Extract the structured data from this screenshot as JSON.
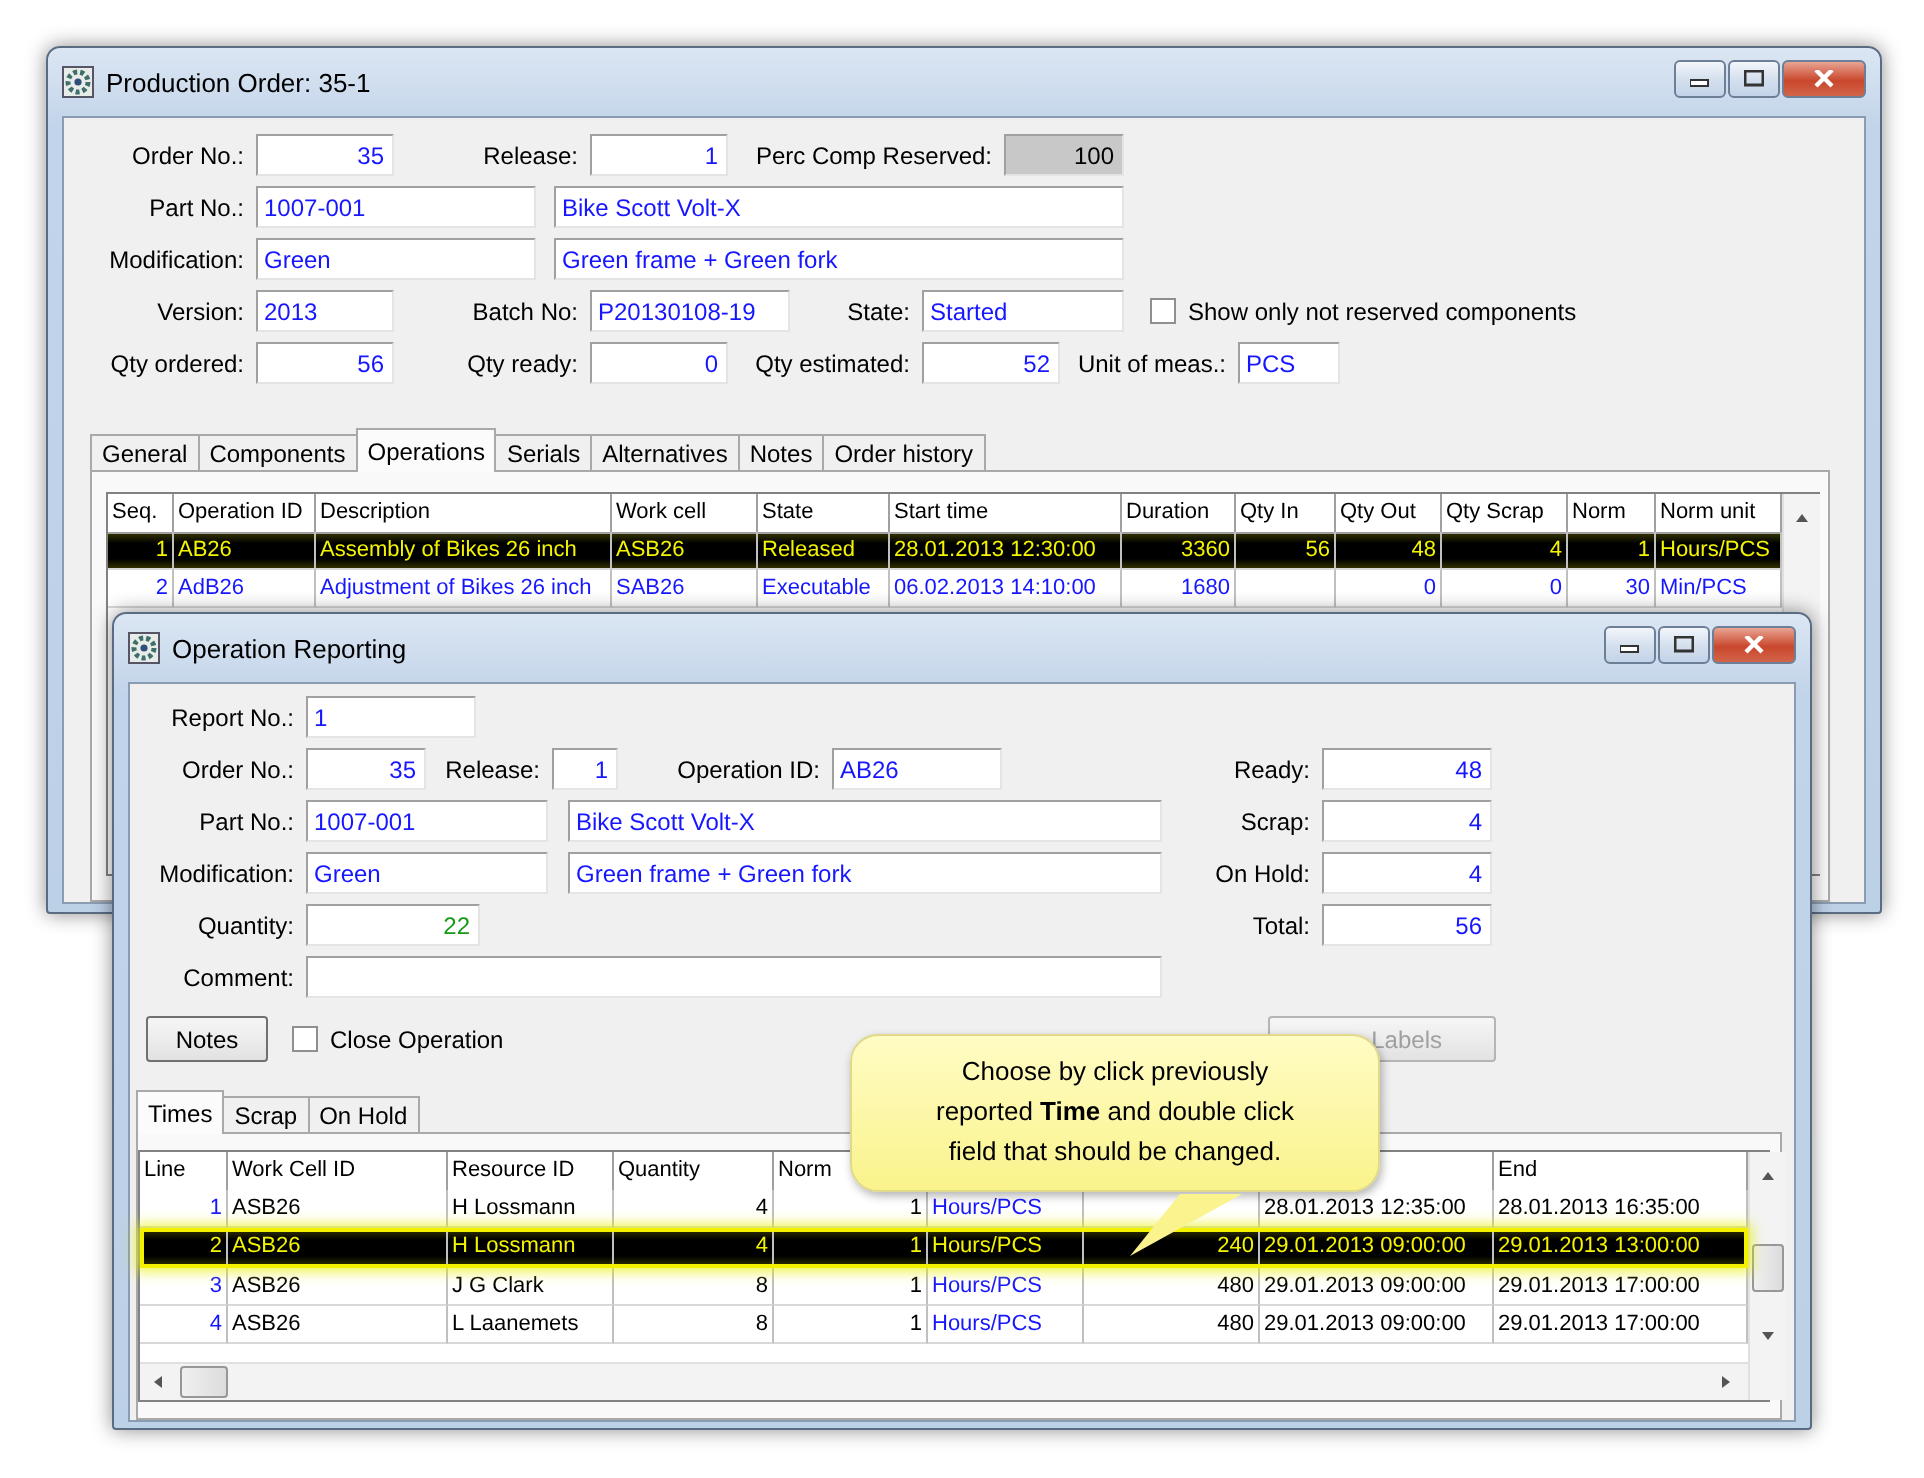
{
  "production_order": {
    "title": "Production Order: 35-1",
    "fields": {
      "order_no": {
        "label": "Order No.:",
        "value": "35"
      },
      "release": {
        "label": "Release:",
        "value": "1"
      },
      "perc_comp_reserved": {
        "label": "Perc Comp Reserved:",
        "value": "100"
      },
      "part_no": {
        "label": "Part No.:",
        "value": "1007-001",
        "description": "Bike Scott Volt-X"
      },
      "modification": {
        "label": "Modification:",
        "value": "Green",
        "description": "Green frame + Green fork"
      },
      "version": {
        "label": "Version:",
        "value": "2013"
      },
      "batch_no": {
        "label": "Batch No:",
        "value": "P20130108-19"
      },
      "state": {
        "label": "State:",
        "value": "Started"
      },
      "qty_ordered": {
        "label": "Qty ordered:",
        "value": "56"
      },
      "qty_ready": {
        "label": "Qty ready:",
        "value": "0"
      },
      "qty_estimated": {
        "label": "Qty estimated:",
        "value": "52"
      },
      "unit_of_meas": {
        "label": "Unit of meas.:",
        "value": "PCS"
      }
    },
    "show_only_not_reserved": {
      "label": "Show only not reserved components",
      "checked": false
    },
    "tabs": [
      {
        "label": "General",
        "selected": false
      },
      {
        "label": "Components",
        "selected": false
      },
      {
        "label": "Operations",
        "selected": true
      },
      {
        "label": "Serials",
        "selected": false
      },
      {
        "label": "Alternatives",
        "selected": false
      },
      {
        "label": "Notes",
        "selected": false
      },
      {
        "label": "Order history",
        "selected": false
      }
    ],
    "table": {
      "columns": {
        "seq": "Seq.",
        "operation_id": "Operation ID",
        "description": "Description",
        "work_cell": "Work cell",
        "state": "State",
        "start_time": "Start time",
        "duration": "Duration",
        "qty_in": "Qty In",
        "qty_out": "Qty Out",
        "qty_scrap": "Qty Scrap",
        "norm": "Norm",
        "norm_unit": "Norm unit"
      },
      "rows": [
        {
          "selected": true,
          "seq": "1",
          "operation_id": "AB26",
          "description": "Assembly of Bikes 26 inch",
          "work_cell": "ASB26",
          "state": "Released",
          "start_time": "28.01.2013 12:30:00",
          "duration": "3360",
          "qty_in": "56",
          "qty_out": "48",
          "qty_scrap": "4",
          "norm": "1",
          "norm_unit": "Hours/PCS"
        },
        {
          "selected": false,
          "seq": "2",
          "operation_id": "AdB26",
          "description": "Adjustment of Bikes 26 inch",
          "work_cell": "SAB26",
          "state": "Executable",
          "start_time": "06.02.2013 14:10:00",
          "duration": "1680",
          "qty_out": "0",
          "qty_scrap": "0",
          "norm": "30",
          "norm_unit": "Min/PCS"
        }
      ]
    }
  },
  "operation_reporting": {
    "title": "Operation Reporting",
    "fields": {
      "report_no": {
        "label": "Report No.:",
        "value": "1"
      },
      "order_no": {
        "label": "Order No.:",
        "value": "35"
      },
      "release": {
        "label": "Release:",
        "value": "1"
      },
      "operation_id": {
        "label": "Operation ID:",
        "value": "AB26"
      },
      "part_no": {
        "label": "Part No.:",
        "value": "1007-001",
        "description": "Bike Scott Volt-X"
      },
      "modification": {
        "label": "Modification:",
        "value": "Green",
        "description": "Green frame + Green fork"
      },
      "quantity": {
        "label": "Quantity:",
        "value": "22"
      },
      "comment": {
        "label": "Comment:"
      },
      "ready": {
        "label": "Ready:",
        "value": "48"
      },
      "scrap": {
        "label": "Scrap:",
        "value": "4"
      },
      "on_hold": {
        "label": "On Hold:",
        "value": "4"
      },
      "total": {
        "label": "Total:",
        "value": "56"
      }
    },
    "notes_button": {
      "label": "Notes"
    },
    "close_operation": {
      "label": "Close Operation",
      "checked": false
    },
    "labels_button": {
      "label": "Labels",
      "disabled": true
    },
    "tabs": [
      {
        "label": "Times",
        "selected": true
      },
      {
        "label": "Scrap",
        "selected": false
      },
      {
        "label": "On Hold",
        "selected": false
      }
    ],
    "table": {
      "columns": {
        "line": "Line",
        "work_cell_id": "Work Cell ID",
        "resource_id": "Resource ID",
        "quantity": "Quantity",
        "norm": "Norm",
        "end": "End"
      },
      "rows": [
        {
          "selected": false,
          "line": "1",
          "work_cell_id": "ASB26",
          "resource_id": "H Lossmann",
          "quantity": "4",
          "norm": "1",
          "column_6": "Hours/PCS",
          "column_8": "28.01.2013 12:35:00",
          "end": "28.01.2013 16:35:00"
        },
        {
          "selected": true,
          "line": "2",
          "work_cell_id": "ASB26",
          "resource_id": "H Lossmann",
          "quantity": "4",
          "norm": "1",
          "column_6": "Hours/PCS",
          "column_7": "240",
          "column_8": "29.01.2013 09:00:00",
          "end": "29.01.2013 13:00:00"
        },
        {
          "selected": false,
          "line": "3",
          "work_cell_id": "ASB26",
          "resource_id": "J G Clark",
          "quantity": "8",
          "norm": "1",
          "column_6": "Hours/PCS",
          "column_7": "480",
          "column_8": "29.01.2013 09:00:00",
          "end": "29.01.2013 17:00:00"
        },
        {
          "selected": false,
          "line": "4",
          "work_cell_id": "ASB26",
          "resource_id": "L Laanemets",
          "quantity": "8",
          "norm": "1",
          "column_6": "Hours/PCS",
          "column_7": "480",
          "column_8": "29.01.2013 09:00:00",
          "end": "29.01.2013 17:00:00"
        }
      ]
    }
  },
  "callout": {
    "lines": [
      "Choose by click previously",
      "reported **Time** and double click",
      "field that should be changed."
    ]
  }
}
